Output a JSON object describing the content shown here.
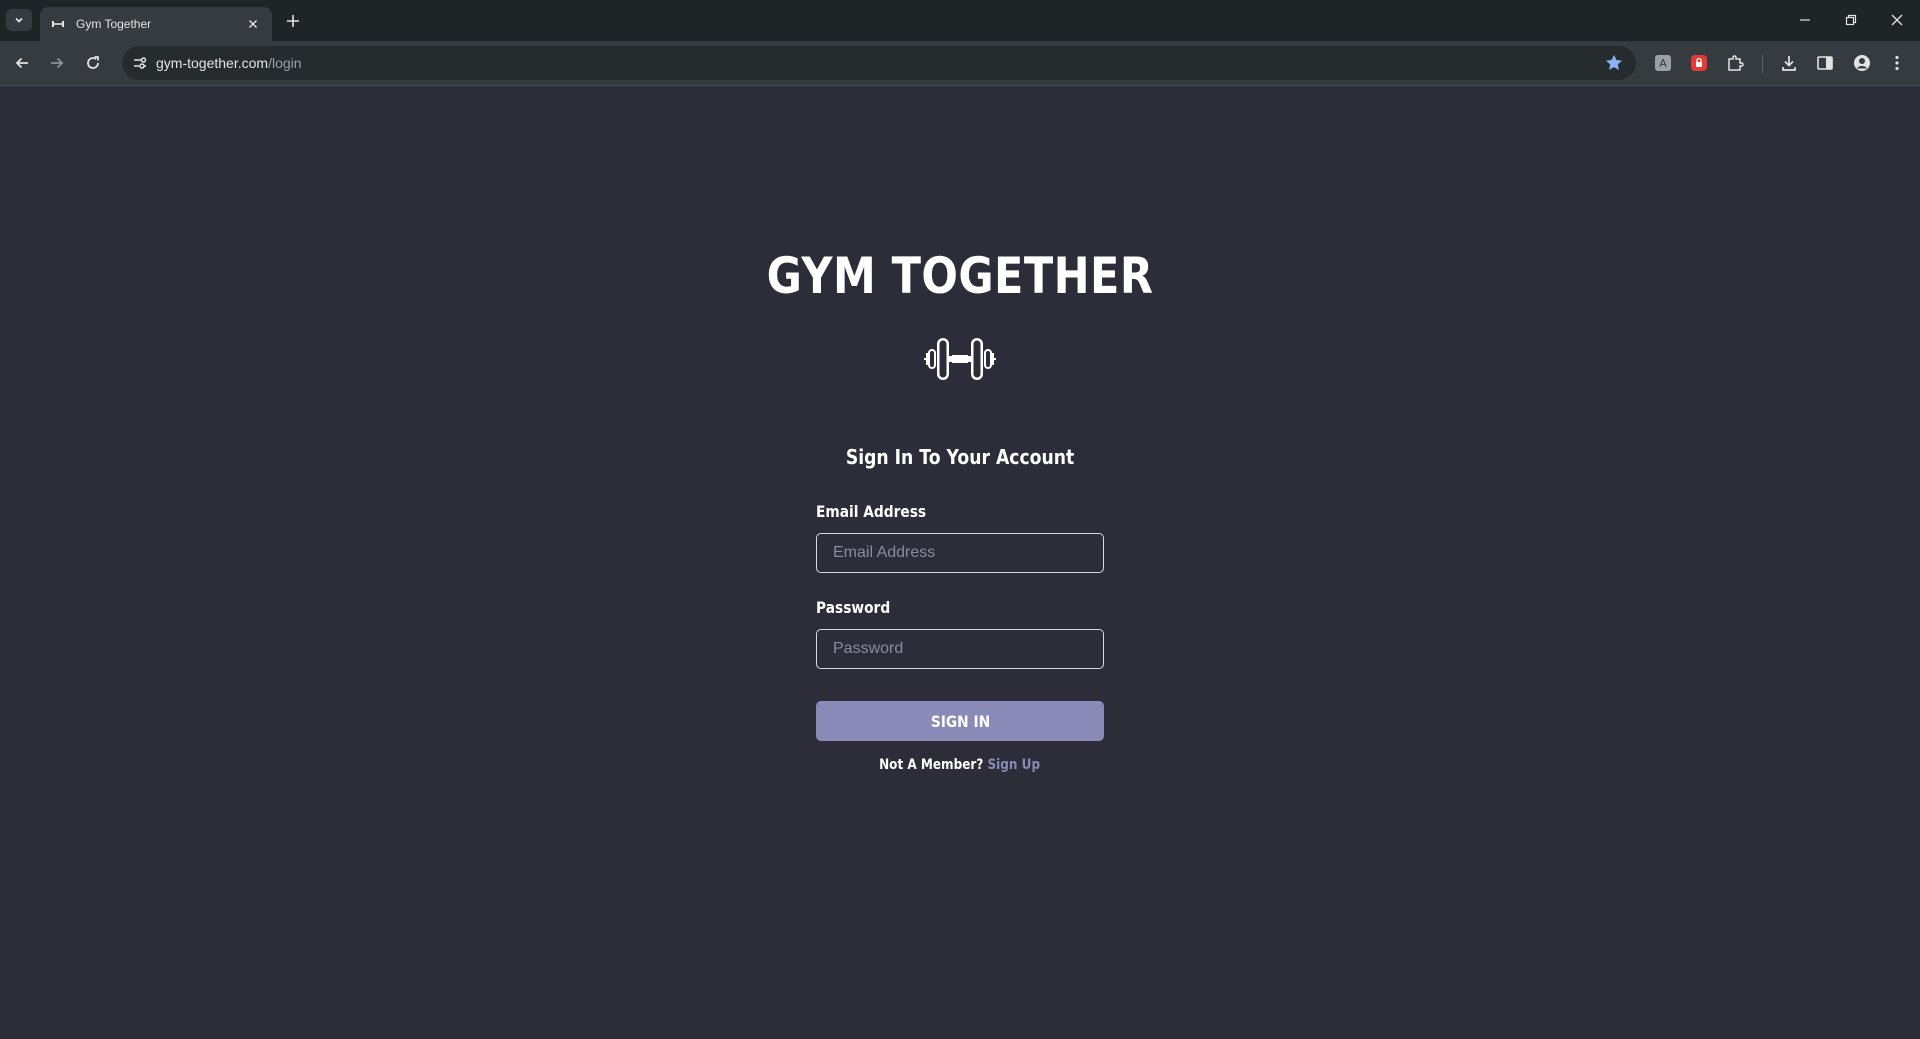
{
  "browser": {
    "tab_title": "Gym Together",
    "url_host": "gym-together.com",
    "url_path": "/login"
  },
  "page": {
    "brand": "GYM TOGETHER",
    "logo_icon": "dumbbell-icon",
    "heading": "Sign In To Your Account",
    "email_label": "Email Address",
    "email_placeholder": "Email Address",
    "email_value": "",
    "password_label": "Password",
    "password_placeholder": "Password",
    "password_value": "",
    "signin_label": "SIGN IN",
    "member_prompt": "Not A Member?",
    "signup_label": "Sign Up"
  },
  "colors": {
    "page_bg": "#2d2d39",
    "accent": "#8a8ab8",
    "text": "#ffffff",
    "bookmark_star": "#8ab4f8",
    "extension_red": "#e53935"
  }
}
